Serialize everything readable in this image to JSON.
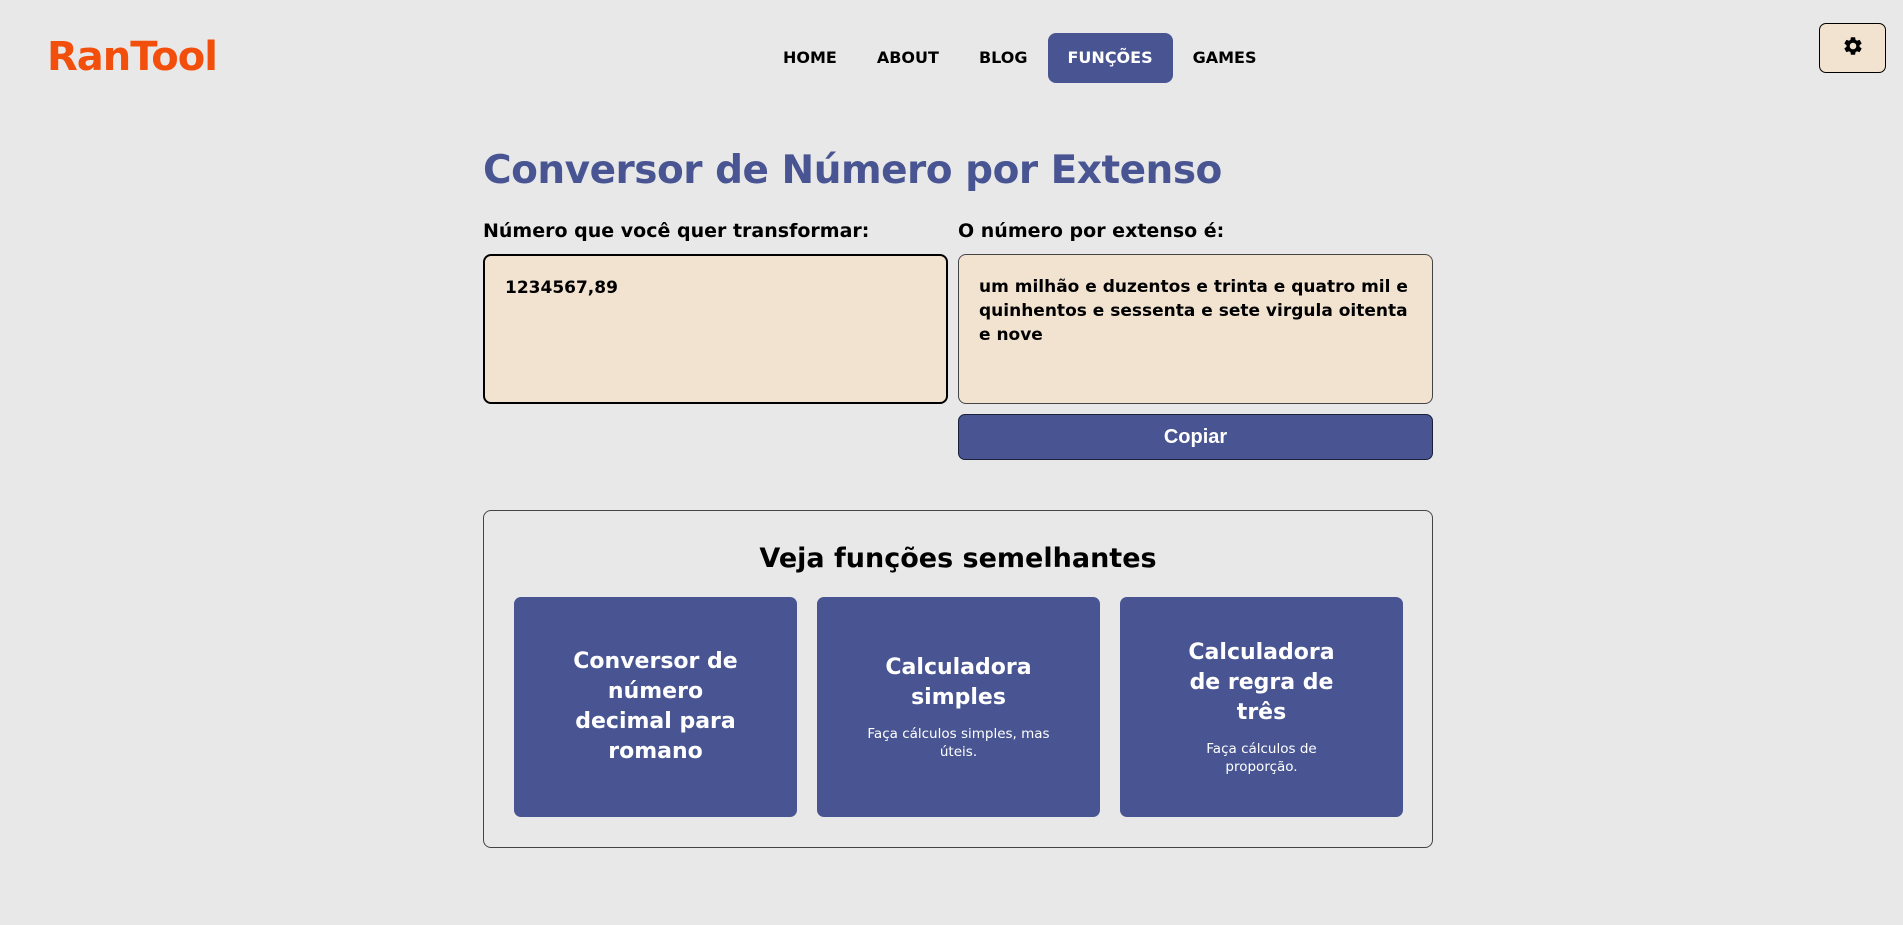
{
  "header": {
    "logo": "RanTool",
    "nav": [
      {
        "label": "HOME",
        "active": false
      },
      {
        "label": "ABOUT",
        "active": false
      },
      {
        "label": "BLOG",
        "active": false
      },
      {
        "label": "FUNÇÕES",
        "active": true
      },
      {
        "label": "GAMES",
        "active": false
      }
    ],
    "settings_icon": "gear-icon"
  },
  "main": {
    "title": "Conversor de Número por Extenso",
    "input_label": "Número que você quer transformar:",
    "input_value": "1234567,89",
    "output_label": "O número por extenso é:",
    "output_value": "um milhão e duzentos e trinta e quatro mil e quinhentos e sessenta e sete virgula oitenta e nove",
    "copy_label": "Copiar"
  },
  "related": {
    "title": "Veja funções semelhantes",
    "cards": [
      {
        "title": "Conversor de número decimal para romano",
        "desc": ""
      },
      {
        "title": "Calculadora simples",
        "desc": "Faça cálculos simples, mas úteis."
      },
      {
        "title": "Calculadora de regra de três",
        "desc": "Faça cálculos de proporção."
      }
    ]
  },
  "colors": {
    "background": "#e8e8e8",
    "brand": "#f24e0c",
    "accent": "#485592",
    "field": "#f2e3d1"
  }
}
